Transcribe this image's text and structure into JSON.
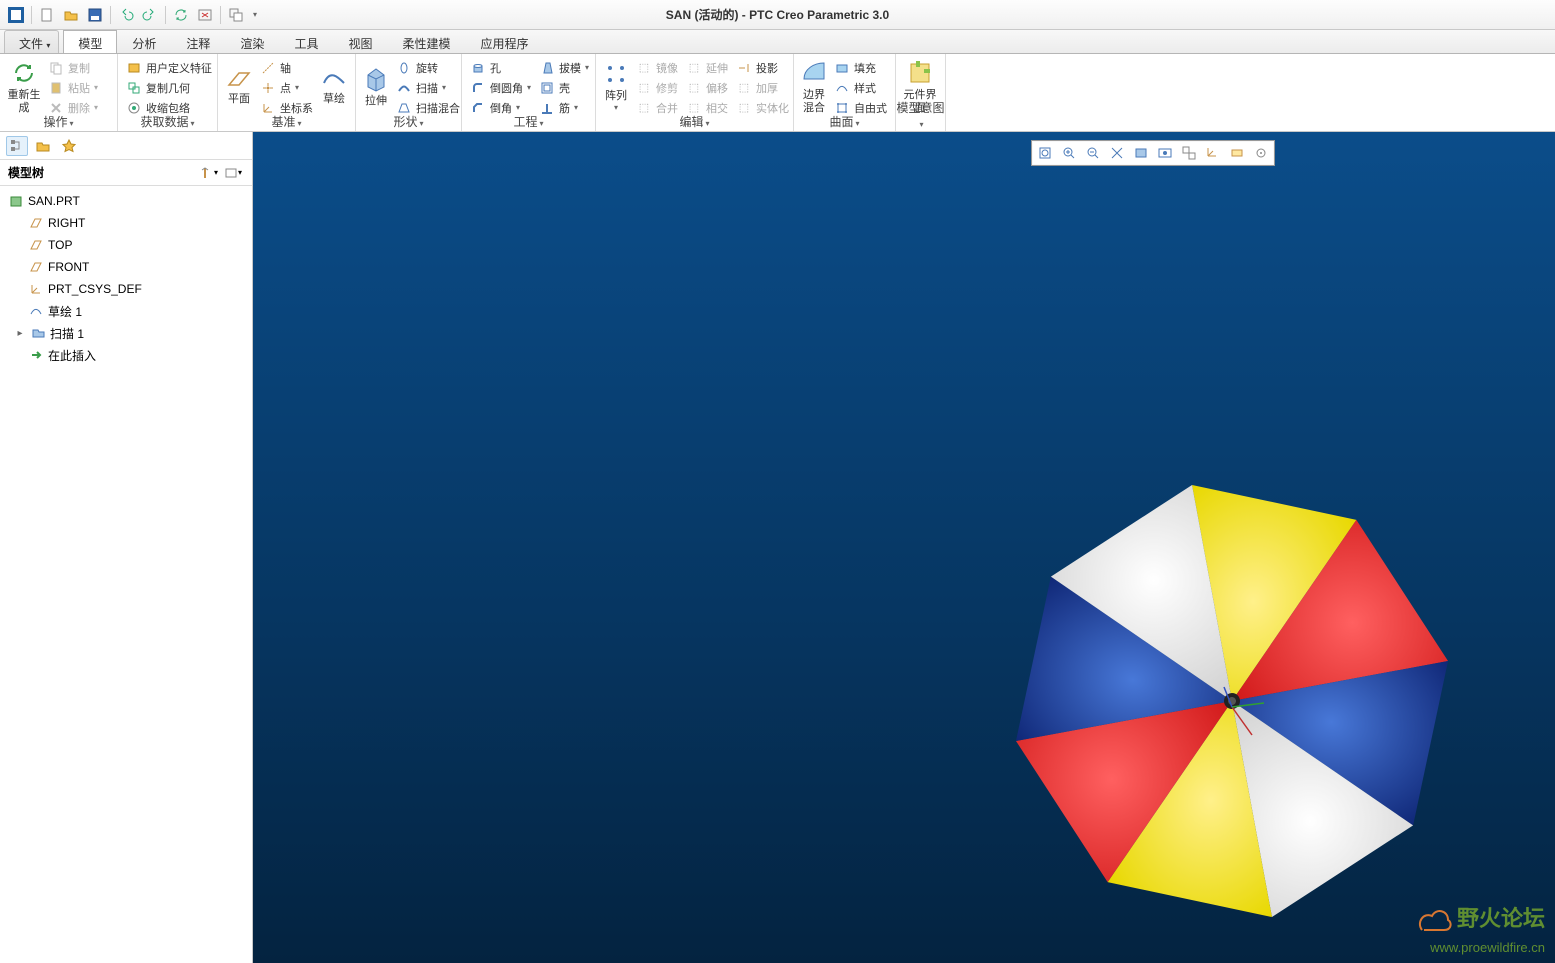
{
  "title": "SAN (活动的) - PTC Creo Parametric 3.0",
  "tabs": {
    "file": "文件",
    "items": [
      "模型",
      "分析",
      "注释",
      "渲染",
      "工具",
      "视图",
      "柔性建模",
      "应用程序"
    ],
    "active": 0
  },
  "ribbon": {
    "groups": [
      {
        "name": "操作",
        "big": [
          {
            "id": "regen",
            "label": "重新生成"
          }
        ],
        "cols": [
          [
            {
              "id": "copy",
              "label": "复制",
              "dis": true
            },
            {
              "id": "paste",
              "label": "粘贴",
              "dis": true,
              "dd": true
            },
            {
              "id": "delete",
              "label": "删除",
              "dis": true
            }
          ]
        ]
      },
      {
        "name": "获取数据",
        "cols": [
          [
            {
              "id": "udf",
              "label": "用户定义特征"
            },
            {
              "id": "copygeom",
              "label": "复制几何"
            },
            {
              "id": "shrink",
              "label": "收缩包络"
            }
          ]
        ]
      },
      {
        "name": "基准",
        "big": [
          {
            "id": "plane",
            "label": "平面"
          }
        ],
        "cols": [
          [
            {
              "id": "axis",
              "label": "轴"
            },
            {
              "id": "point",
              "label": "点",
              "dd": true
            },
            {
              "id": "csys",
              "label": "坐标系"
            }
          ]
        ],
        "big2": [
          {
            "id": "sketch",
            "label": "草绘"
          }
        ]
      },
      {
        "name": "形状",
        "big": [
          {
            "id": "extrude",
            "label": "拉伸"
          }
        ],
        "cols": [
          [
            {
              "id": "revolve",
              "label": "旋转"
            },
            {
              "id": "sweep",
              "label": "扫描",
              "dd": true
            },
            {
              "id": "blend",
              "label": "扫描混合"
            }
          ]
        ]
      },
      {
        "name": "工程",
        "cols": [
          [
            {
              "id": "hole",
              "label": "孔"
            },
            {
              "id": "round",
              "label": "倒圆角",
              "dd": true
            },
            {
              "id": "chamfer",
              "label": "倒角",
              "dd": true
            }
          ],
          [
            {
              "id": "draft",
              "label": "拔模",
              "dd": true
            },
            {
              "id": "shell",
              "label": "壳"
            },
            {
              "id": "rib",
              "label": "筋",
              "dd": true
            }
          ]
        ]
      },
      {
        "name": "编辑",
        "big": [
          {
            "id": "pattern",
            "label": "阵列"
          }
        ],
        "cols": [
          [
            {
              "id": "mirror",
              "label": "镜像",
              "dis": true
            },
            {
              "id": "trim",
              "label": "修剪",
              "dis": true
            },
            {
              "id": "merge",
              "label": "合并",
              "dis": true
            }
          ],
          [
            {
              "id": "extend",
              "label": "延伸",
              "dis": true
            },
            {
              "id": "offset",
              "label": "偏移",
              "dis": true
            },
            {
              "id": "intersect",
              "label": "相交",
              "dis": true
            }
          ],
          [
            {
              "id": "project",
              "label": "投影"
            },
            {
              "id": "thicken",
              "label": "加厚",
              "dis": true
            },
            {
              "id": "solidify",
              "label": "实体化",
              "dis": true
            }
          ]
        ]
      },
      {
        "name": "曲面",
        "big": [
          {
            "id": "bblend",
            "label": "边界混合"
          }
        ],
        "cols": [
          [
            {
              "id": "fill",
              "label": "填充"
            },
            {
              "id": "style",
              "label": "样式"
            },
            {
              "id": "freeform",
              "label": "自由式"
            }
          ]
        ]
      },
      {
        "name": "模型意图",
        "big": [
          {
            "id": "compui",
            "label": "元件界面"
          }
        ]
      }
    ]
  },
  "tree": {
    "header": "模型树",
    "root": "SAN.PRT",
    "items": [
      {
        "id": "right",
        "label": "RIGHT",
        "type": "plane"
      },
      {
        "id": "top",
        "label": "TOP",
        "type": "plane"
      },
      {
        "id": "front",
        "label": "FRONT",
        "type": "plane"
      },
      {
        "id": "csys",
        "label": "PRT_CSYS_DEF",
        "type": "csys"
      },
      {
        "id": "sk1",
        "label": "草绘 1",
        "type": "sketch"
      },
      {
        "id": "sw1",
        "label": "扫描 1",
        "type": "sweep",
        "exp": "▸"
      },
      {
        "id": "ins",
        "label": "在此插入",
        "type": "insert"
      }
    ]
  },
  "watermark": {
    "l1": "野火论坛",
    "l2": "www.proewildfire.cn"
  }
}
